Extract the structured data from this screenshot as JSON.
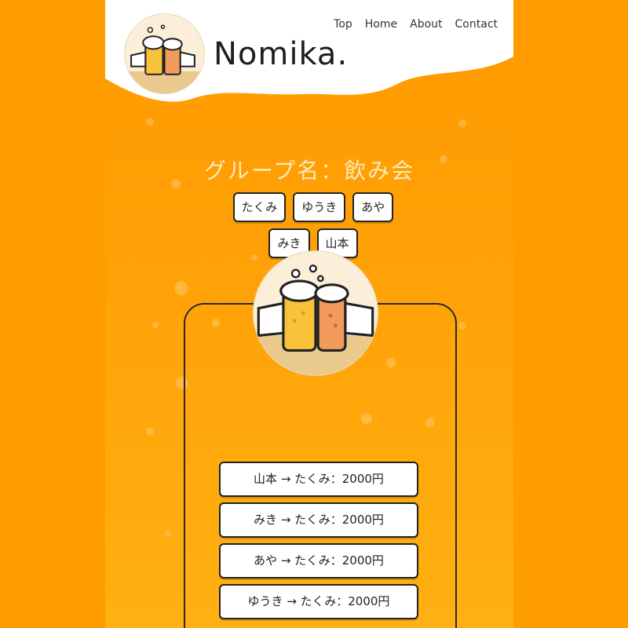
{
  "header": {
    "brand": "Nomika.",
    "nav": [
      "Top",
      "Home",
      "About",
      "Contact"
    ]
  },
  "group": {
    "title": "グループ名：飲み会",
    "members": [
      "たくみ",
      "ゆうき",
      "あや",
      "みき",
      "山本"
    ]
  },
  "payments": [
    "山本 → たくみ：2000円",
    "みき → たくみ：2000円",
    "あや → たくみ：2000円",
    "ゆうき → たくみ：2000円"
  ],
  "colors": {
    "background": "#ff9d00",
    "header": "#ffffff",
    "beer": "#f8c23a",
    "beer_alt": "#f39b5d"
  },
  "icons": [
    "beer-toast-logo-icon",
    "beer-toast-illustration-icon"
  ]
}
